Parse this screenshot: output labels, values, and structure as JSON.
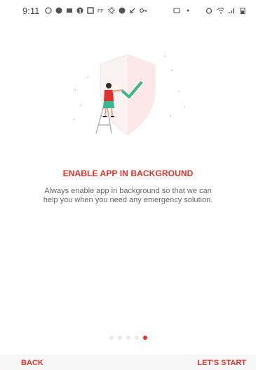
{
  "status_bar": {
    "time": "9:11",
    "left_icons": [
      "whatsapp-icon",
      "messenger-icon",
      "app-icon",
      "facebook-icon",
      "flipboard-icon",
      "ff-icon",
      "sun-icon",
      "messenger-icon",
      "call-icon",
      "key-icon"
    ],
    "right_icons": [
      "screenshot-icon",
      "dot-icon",
      "alarm-icon",
      "wifi-icon",
      "signal-icon",
      "battery-icon"
    ]
  },
  "onboarding": {
    "title": "ENABLE APP IN BACKGROUND",
    "description": "Always enable app in background so that we can help you when you need any emergency solution."
  },
  "pager": {
    "count": 5,
    "active_index": 4
  },
  "navigation": {
    "back_label": "BACK",
    "start_label": "LET'S START"
  },
  "colors": {
    "accent": "#e0312c",
    "text_muted": "#666666",
    "bottom_bar": "#f6f6f6",
    "check": "#3bb78f"
  }
}
